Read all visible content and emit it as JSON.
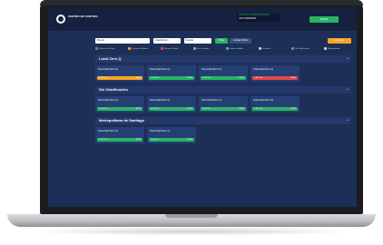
{
  "header": {
    "logo_text": "CENTRO DE CONTROL",
    "user_line1": "USUARIO ADMINISTRADOR",
    "user_line2": "+56 9 00000000",
    "button_label": "SALIR"
  },
  "filters": {
    "search_placeholder": "Buscar...",
    "select_one_value": "Clasificación",
    "select_two_value": "Estado",
    "apply_label": "Filtrar",
    "clear_label": "Limpiar Filtros",
    "export_label": "Exportar"
  },
  "legend": [
    {
      "label": "Sucursal en Línea",
      "color": "#28b463"
    },
    {
      "label": "Sucursal en Alerta",
      "color": "#f5a623"
    },
    {
      "label": "Sucursal Caída",
      "color": "#e04a4a"
    },
    {
      "label": "Sin Conexión",
      "color": "#9aa4b8"
    },
    {
      "label": "Datos recibidos",
      "color": "#4aa3df"
    },
    {
      "label": "Sin datos",
      "color": "#c7ccd6"
    },
    {
      "label": "Sin Clasificación",
      "color": "#7f8aa3"
    },
    {
      "label": "Metropolitana",
      "color": "#cfd6e6"
    }
  ],
  "sections": [
    {
      "title": "Local Zero Q",
      "toggle": "^",
      "cards": [
        {
          "title": "Sucursal Zero Q",
          "left": "1 ok  2 ok",
          "right": "$0  $0",
          "status_color": "#f5a623"
        },
        {
          "title": "Sucursal Zero Q",
          "left": "1 ok  2 ok",
          "right": "$0  $0",
          "status_color": "#28b463"
        },
        {
          "title": "Sucursal Zero Q",
          "left": "1 ok  2 ok",
          "right": "$0  $0",
          "status_color": "#28b463"
        },
        {
          "title": "Sucursal Zero Q",
          "left": "1 ok  2 ok",
          "right": "$0  $0",
          "status_color": "#e04a4a"
        }
      ]
    },
    {
      "title": "Sin Clasificación",
      "toggle": "^",
      "cards": [
        {
          "title": "Sucursal Zero Q",
          "left": "1 ok  2 ok",
          "right": "$0  $0",
          "status_color": "#28b463"
        },
        {
          "title": "Sucursal Zero Q",
          "left": "1 ok  2 ok",
          "right": "$0  $0",
          "status_color": "#28b463"
        },
        {
          "title": "Sucursal Zero Q",
          "left": "1 ok  2 ok",
          "right": "$0  $0",
          "status_color": "#28b463"
        },
        {
          "title": "Sucursal Zero Q",
          "left": "1 ok  2 ok",
          "right": "$0  $0",
          "status_color": "#28b463"
        }
      ]
    },
    {
      "title": "Metropolitana de Santiago",
      "toggle": "^",
      "cards": [
        {
          "title": "Sucursal Zero Q",
          "left": "1 ok  2 ok",
          "right": "$0  $0",
          "status_color": "#28b463"
        },
        {
          "title": "Sucursal Zero Q",
          "left": "1 ok  2 ok",
          "right": "$0  $0",
          "status_color": "#28b463"
        }
      ]
    }
  ]
}
